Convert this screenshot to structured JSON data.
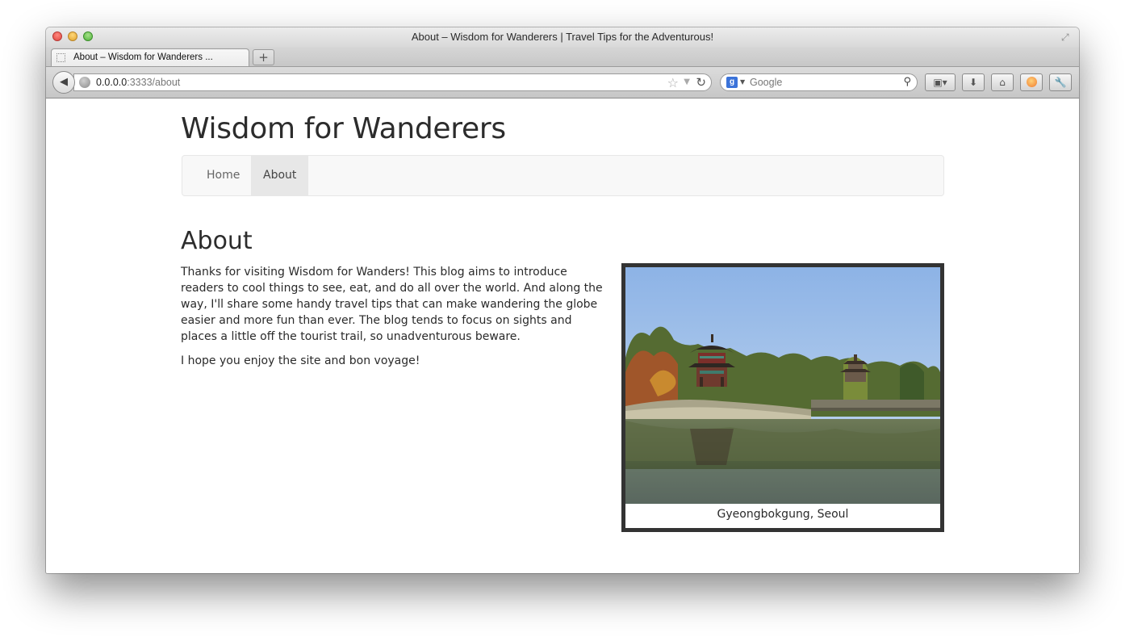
{
  "browser": {
    "window_title": "About – Wisdom for Wanderers | Travel Tips for the Adventurous!",
    "tab_label": "About – Wisdom for Wanderers ...",
    "new_tab_label": "+",
    "url_host": "0.0.0.0",
    "url_rest": ":3333/about",
    "search_engine_label": "g",
    "search_placeholder": "Google"
  },
  "site": {
    "title": "Wisdom for Wanderers",
    "nav": [
      {
        "label": "Home",
        "active": false
      },
      {
        "label": "About",
        "active": true
      }
    ]
  },
  "page": {
    "heading": "About",
    "paragraphs": [
      "Thanks for visiting Wisdom for Wanders! This blog aims to introduce readers to cool things to see, eat, and do all over the world. And along the way, I'll share some handy travel tips that can make wandering the globe easier and more fun than ever. The blog tends to focus on sights and places a little off the tourist trail, so unadventurous beware.",
      "I hope you enjoy the site and bon voyage!"
    ],
    "figure_caption": "Gyeongbokgung, Seoul"
  },
  "icons": {
    "back": "back-arrow-icon",
    "star": "bookmark-star-icon",
    "reload": "reload-icon",
    "search": "magnifier-icon"
  }
}
